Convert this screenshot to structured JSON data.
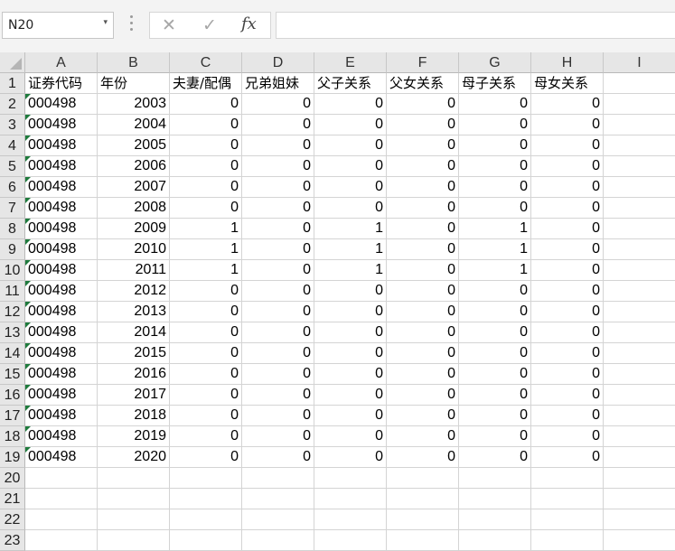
{
  "formula_bar": {
    "name_box": "N20",
    "name_box_arrow": "▾",
    "cancel_icon": "✕",
    "enter_icon": "✓",
    "fx_label": "fx",
    "formula_value": ""
  },
  "sheet": {
    "columns": [
      "A",
      "B",
      "C",
      "D",
      "E",
      "F",
      "G",
      "H",
      "I"
    ],
    "row_numbers": [
      "1",
      "2",
      "3",
      "4",
      "5",
      "6",
      "7",
      "8",
      "9",
      "10",
      "11",
      "12",
      "13",
      "14",
      "15",
      "16",
      "17",
      "18",
      "19",
      "20",
      "21",
      "22",
      "23"
    ],
    "header_row": [
      "证券代码",
      "年份",
      "夫妻/配偶",
      "兄弟姐妹",
      "父子关系",
      "父女关系",
      "母子关系",
      "母女关系",
      ""
    ],
    "rows": [
      [
        "000498",
        "2003",
        "0",
        "0",
        "0",
        "0",
        "0",
        "0"
      ],
      [
        "000498",
        "2004",
        "0",
        "0",
        "0",
        "0",
        "0",
        "0"
      ],
      [
        "000498",
        "2005",
        "0",
        "0",
        "0",
        "0",
        "0",
        "0"
      ],
      [
        "000498",
        "2006",
        "0",
        "0",
        "0",
        "0",
        "0",
        "0"
      ],
      [
        "000498",
        "2007",
        "0",
        "0",
        "0",
        "0",
        "0",
        "0"
      ],
      [
        "000498",
        "2008",
        "0",
        "0",
        "0",
        "0",
        "0",
        "0"
      ],
      [
        "000498",
        "2009",
        "1",
        "0",
        "1",
        "0",
        "1",
        "0"
      ],
      [
        "000498",
        "2010",
        "1",
        "0",
        "1",
        "0",
        "1",
        "0"
      ],
      [
        "000498",
        "2011",
        "1",
        "0",
        "1",
        "0",
        "1",
        "0"
      ],
      [
        "000498",
        "2012",
        "0",
        "0",
        "0",
        "0",
        "0",
        "0"
      ],
      [
        "000498",
        "2013",
        "0",
        "0",
        "0",
        "0",
        "0",
        "0"
      ],
      [
        "000498",
        "2014",
        "0",
        "0",
        "0",
        "0",
        "0",
        "0"
      ],
      [
        "000498",
        "2015",
        "0",
        "0",
        "0",
        "0",
        "0",
        "0"
      ],
      [
        "000498",
        "2016",
        "0",
        "0",
        "0",
        "0",
        "0",
        "0"
      ],
      [
        "000498",
        "2017",
        "0",
        "0",
        "0",
        "0",
        "0",
        "0"
      ],
      [
        "000498",
        "2018",
        "0",
        "0",
        "0",
        "0",
        "0",
        "0"
      ],
      [
        "000498",
        "2019",
        "0",
        "0",
        "0",
        "0",
        "0",
        "0"
      ],
      [
        "000498",
        "2020",
        "0",
        "0",
        "0",
        "0",
        "0",
        "0"
      ]
    ],
    "colors": {
      "header_bg": "#e6e6e6",
      "gridline": "#d4d4d4",
      "error_flag": "#1e7a3c"
    }
  }
}
